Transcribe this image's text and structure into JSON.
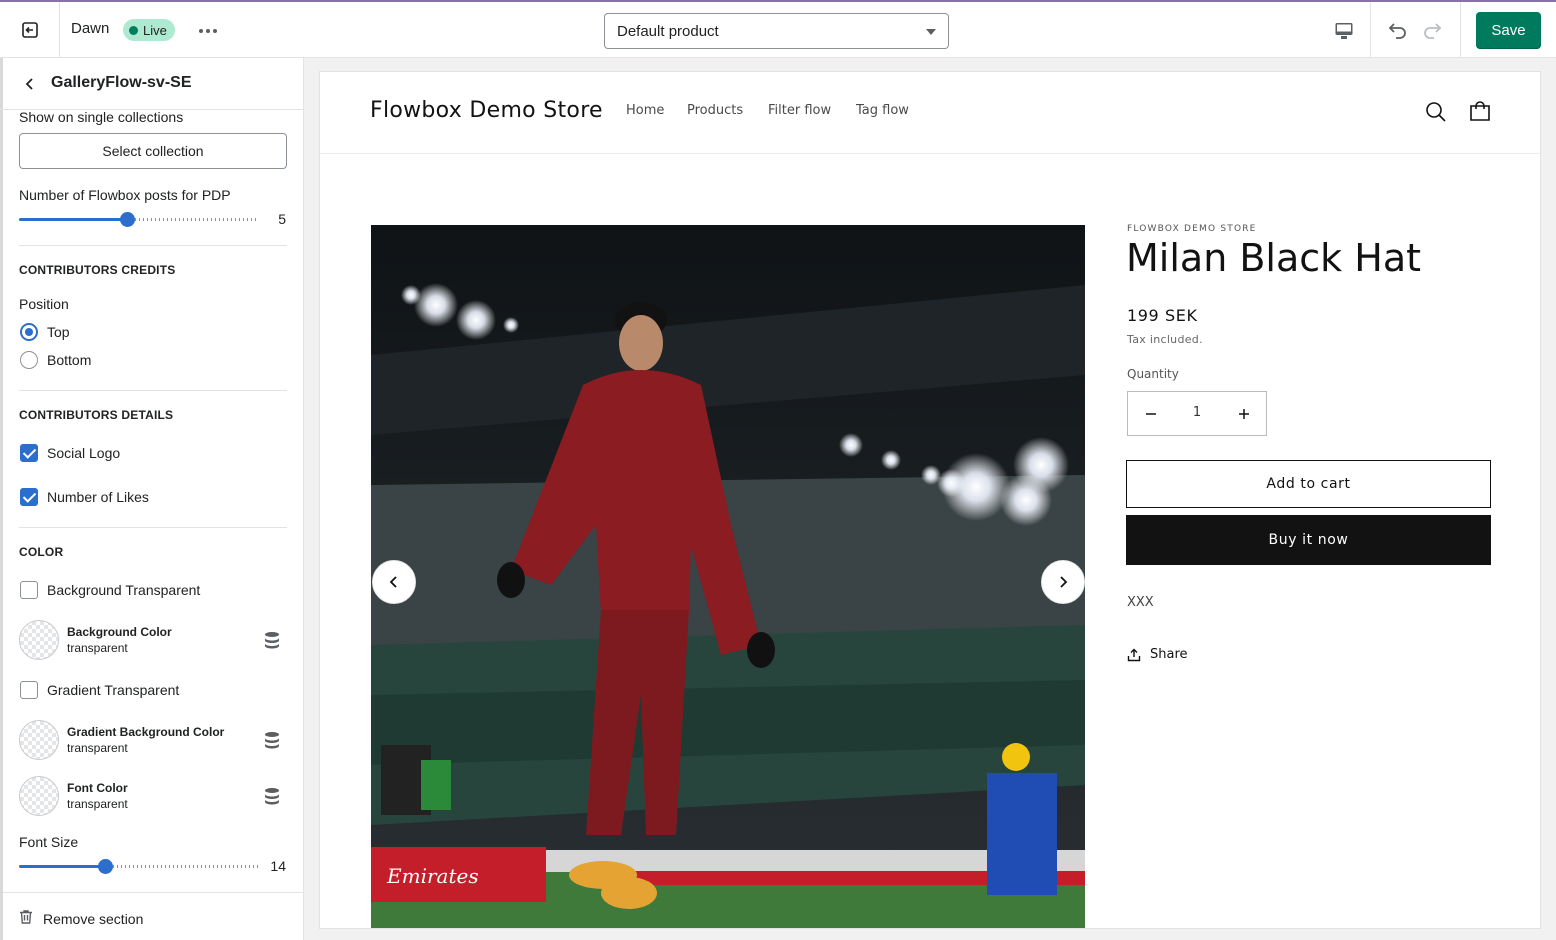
{
  "topbar": {
    "theme_name": "Dawn",
    "live_badge": "Live",
    "template_select": "Default product",
    "save_label": "Save"
  },
  "panel": {
    "title": "GalleryFlow-sv-SE",
    "show_on_label": "Show on single collections",
    "select_collection": "Select collection",
    "posts_label": "Number of Flowbox posts for PDP",
    "posts_value": "5",
    "posts_fraction": 0.45,
    "contributors_credits": "CONTRIBUTORS CREDITS",
    "position_label": "Position",
    "position_options": [
      {
        "label": "Top",
        "selected": true
      },
      {
        "label": "Bottom",
        "selected": false
      }
    ],
    "contributors_details": "CONTRIBUTORS DETAILS",
    "social_logo": {
      "label": "Social Logo",
      "checked": true
    },
    "number_of_likes": {
      "label": "Number of Likes",
      "checked": true
    },
    "color_heading": "COLOR",
    "bg_transparent": {
      "label": "Background Transparent",
      "checked": false
    },
    "bg_color": {
      "name": "Background Color",
      "value": "transparent"
    },
    "gradient_transparent": {
      "label": "Gradient Transparent",
      "checked": false
    },
    "gradient_bg_color": {
      "name": "Gradient Background Color",
      "value": "transparent"
    },
    "font_color": {
      "name": "Font Color",
      "value": "transparent"
    },
    "font_size_label": "Font Size",
    "font_size_value": "14",
    "font_size_fraction": 0.36,
    "remove_section": "Remove section"
  },
  "preview": {
    "store_name": "Flowbox Demo Store",
    "nav": [
      "Home",
      "Products",
      "Filter flow",
      "Tag flow"
    ],
    "vendor": "FLOWBOX DEMO STORE",
    "product_title": "Milan Black Hat",
    "price": "199 SEK",
    "tax_note": "Tax included.",
    "quantity_label": "Quantity",
    "quantity_value": "1",
    "add_to_cart": "Add to cart",
    "buy_now": "Buy it now",
    "description": "XXX",
    "share": "Share",
    "photo_signage": "Emirates"
  },
  "colors": {
    "save_green": "#007a5c",
    "live_badge_bg": "#aee9d1",
    "accent_blue": "#2c6ecb",
    "buy_button": "#121212"
  }
}
